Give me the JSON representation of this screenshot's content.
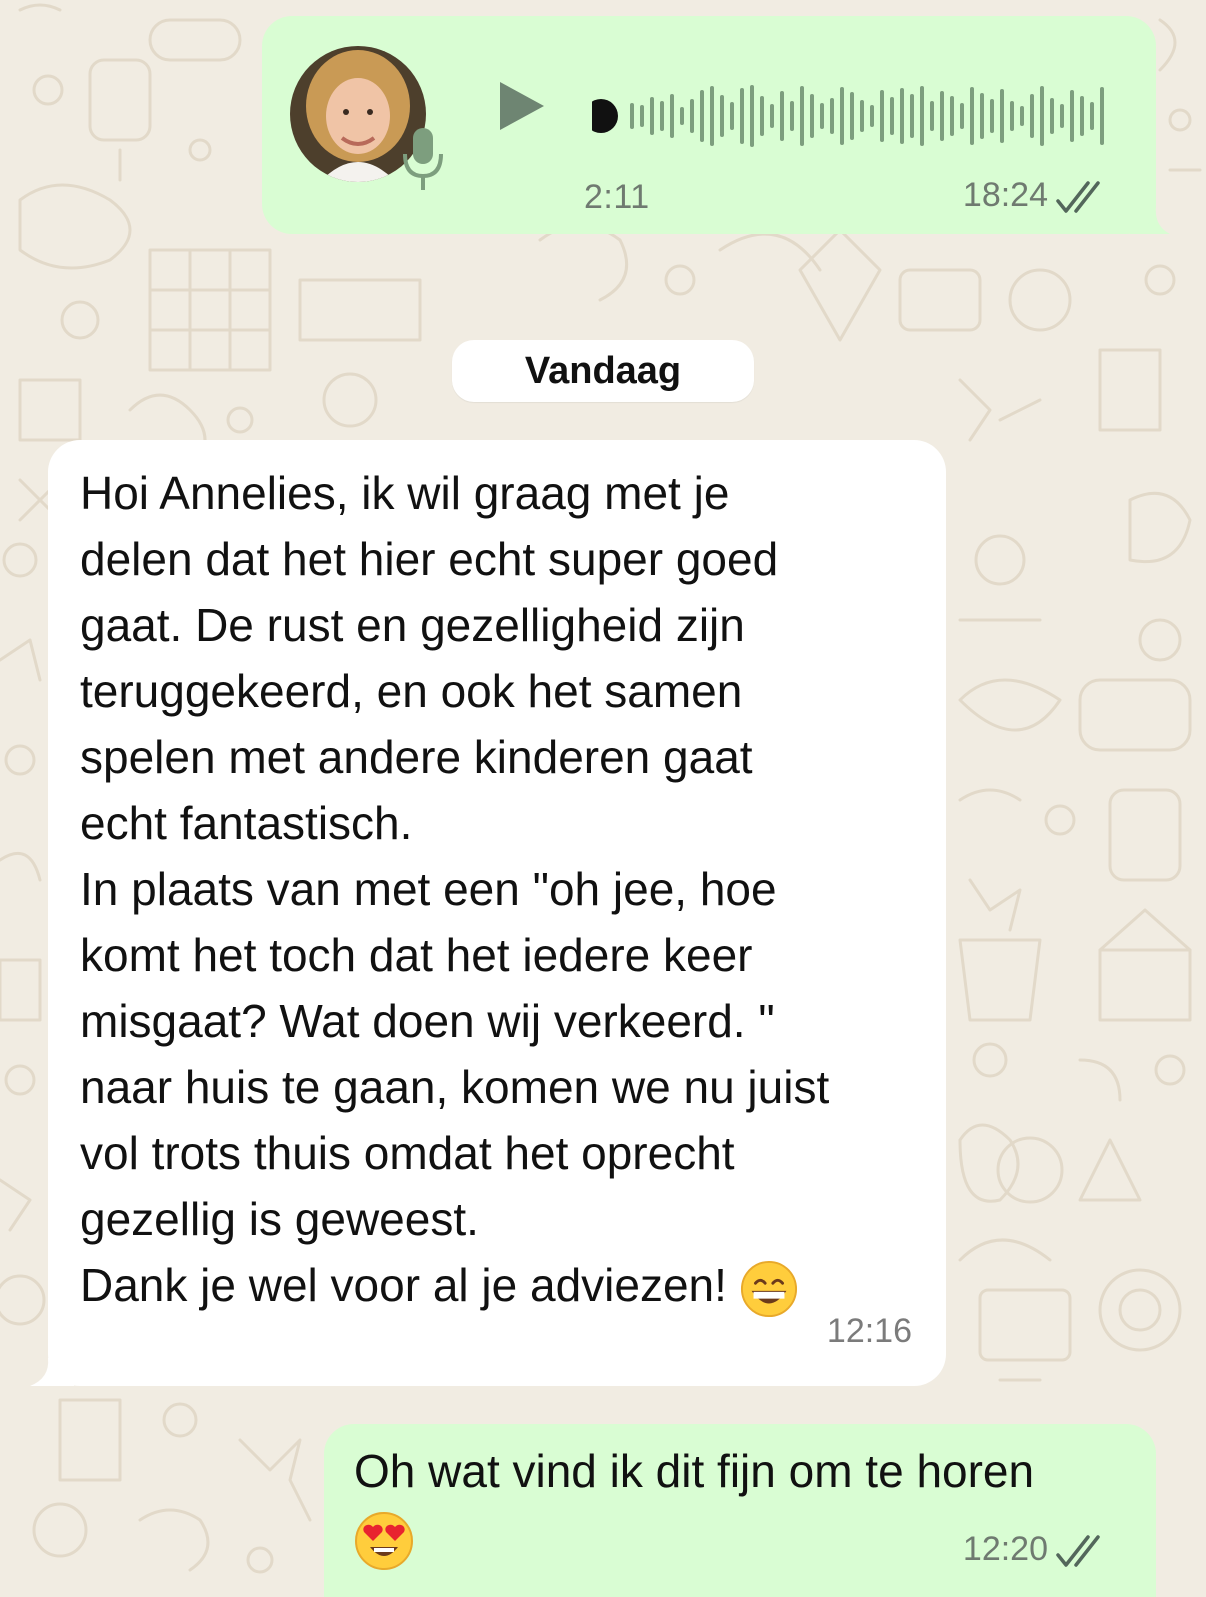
{
  "voice_message": {
    "duration": "2:11",
    "time": "18:24",
    "status": "read",
    "play_icon": "play-icon",
    "mic_icon": "mic-icon"
  },
  "date_divider": "Vandaag",
  "incoming_message": {
    "lines": [
      "Hoi Annelies, ik wil graag met je",
      "delen dat het hier echt super goed",
      "gaat. De rust en gezelligheid zijn",
      "teruggekeerd, en ook het samen",
      "spelen met andere kinderen gaat",
      "echt fantastisch.",
      "In plaats van met een \"oh jee, hoe",
      "komt het toch dat het iedere keer",
      "misgaat? Wat doen wij verkeerd. \"",
      "naar huis te gaan, komen we nu juist",
      "vol trots thuis omdat het oprecht",
      "gezellig is geweest.",
      "Dank je wel voor al je adviezen!"
    ],
    "emoji": "grinning-face",
    "time": "12:16"
  },
  "outgoing_message": {
    "text": "Oh wat vind ik dit fijn om te horen",
    "emoji": "heart-eyes-face",
    "time": "12:20",
    "status": "read"
  },
  "colors": {
    "wallpaper": "#f1ece2",
    "outgoing_bubble": "#d9fdd3",
    "incoming_bubble": "#ffffff",
    "read_ticks": "#53675b",
    "waveform": "#7d9e7e"
  }
}
